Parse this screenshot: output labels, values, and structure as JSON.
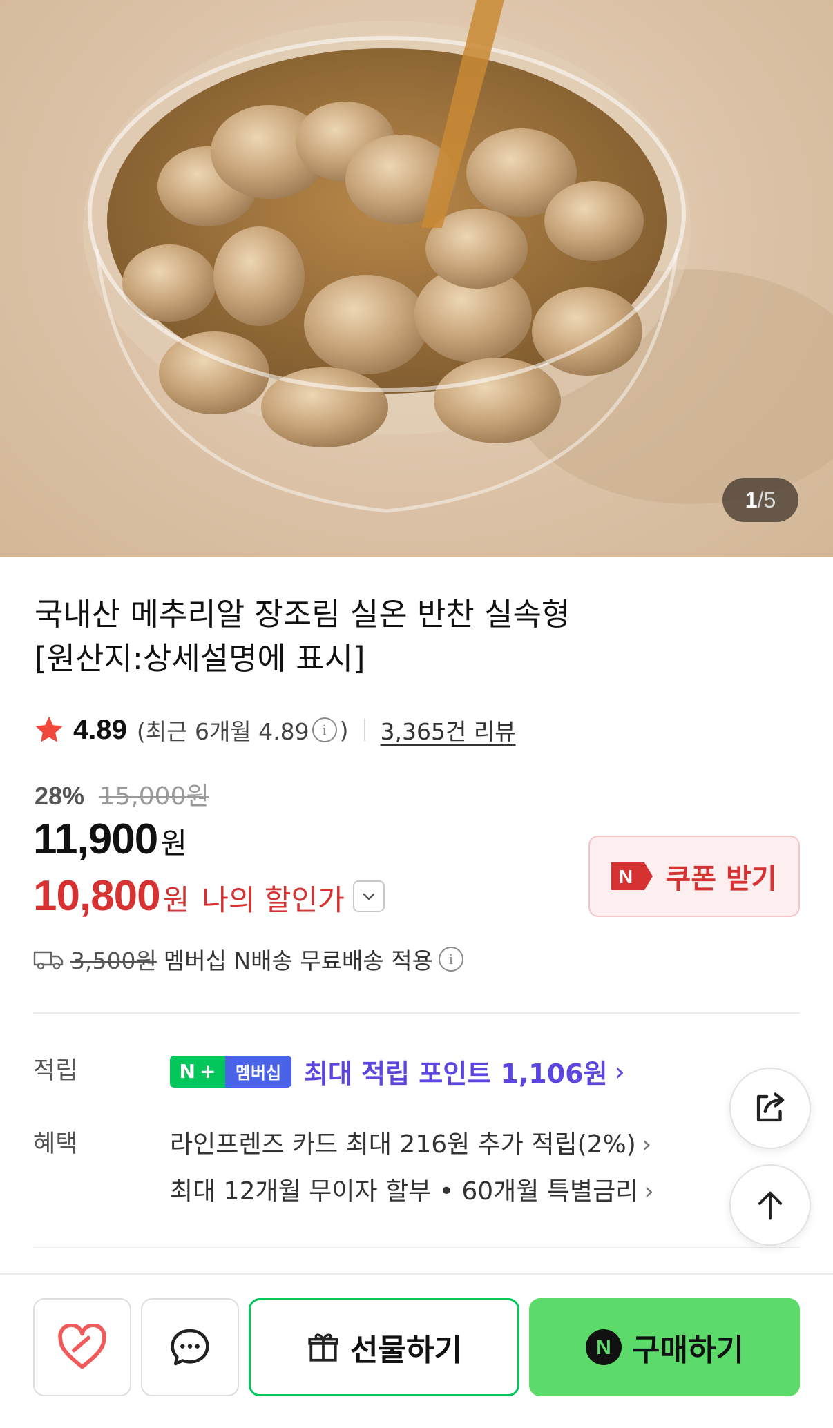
{
  "gallery": {
    "current": "1",
    "separator": "/",
    "total": "5"
  },
  "product": {
    "title_line1": "국내산 메추리알 장조림 실온 반찬 실속형",
    "title_line2": "[원산지:상세설명에 표시]"
  },
  "rating": {
    "score": "4.89",
    "recent_text": "(최근 6개월 4.89",
    "recent_close": ")",
    "review_count": "3,365건 리뷰",
    "star_color": "#f0483a"
  },
  "price": {
    "discount_percent": "28%",
    "original_price": "15,000원",
    "sale_price": "11,900",
    "sale_unit": "원",
    "my_price": "10,800",
    "my_unit": "원",
    "my_label": "나의 할인가",
    "accent_color": "#d63232"
  },
  "coupon": {
    "label": "쿠폰 받기",
    "icon_letter": "N"
  },
  "delivery": {
    "original_fee": "3,500원",
    "text": "멤버십 N배송 무료배송 적용"
  },
  "benefits": {
    "points_label": "적립",
    "badge_n": "N",
    "badge_plus": "+",
    "badge_member": "멤버십",
    "points_text": "최대 적립 포인트 1,106원",
    "points_chevron": "›",
    "perks_label": "혜택",
    "perk_line1": "라인프렌즈 카드 최대 216원 추가 적립(2%)",
    "perk_line2": "최대 12개월 무이자 할부 • 60개월 특별금리",
    "perk_chevron": "›"
  },
  "floating": {
    "share_icon": "share-icon",
    "top_icon": "arrow-up-icon"
  },
  "bottom_bar": {
    "gift_label": "선물하기",
    "buy_label": "구매하기",
    "buy_icon_letter": "N",
    "brand_green": "#03c75a",
    "buy_bg": "#5cdb6b"
  }
}
